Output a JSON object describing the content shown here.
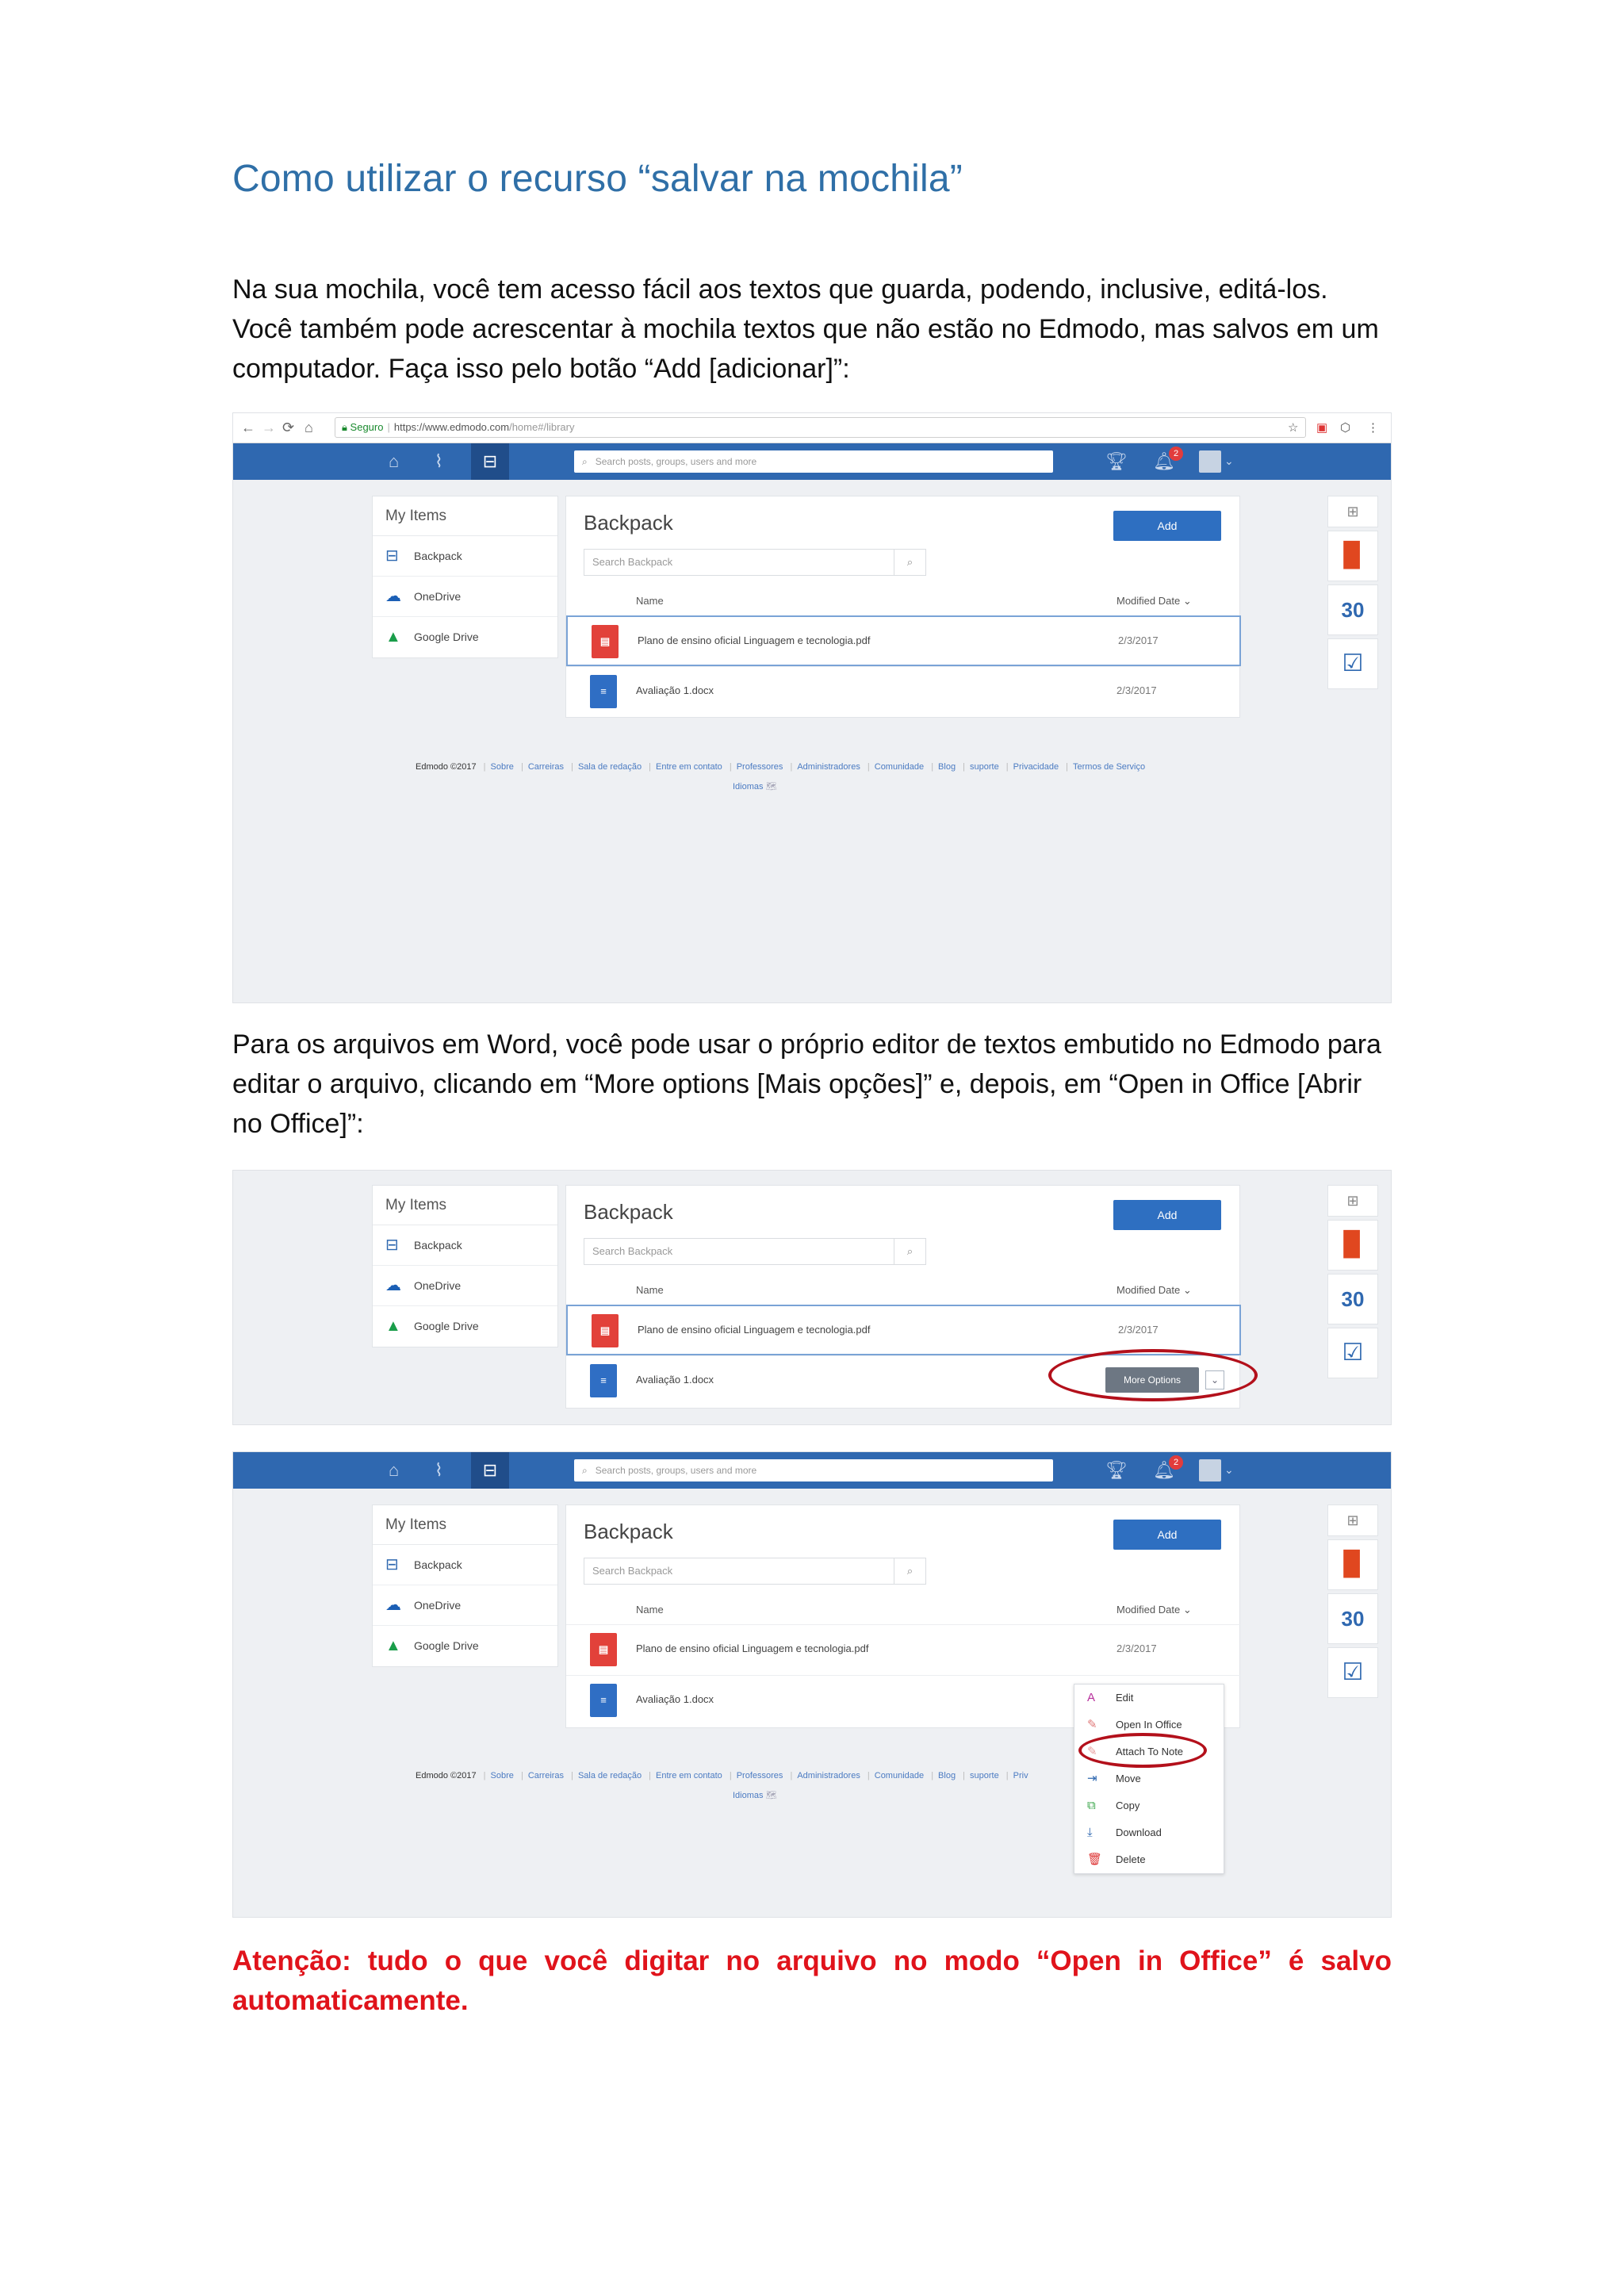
{
  "doc": {
    "title": "Como utilizar o recurso “salvar na mochila”",
    "p1": "Na sua mochila, você tem acesso fácil aos textos que guarda, podendo, inclusive, editá-los. Você também pode acrescentar à mochila textos que não estão no Edmodo, mas salvos em um computador. Faça isso pelo botão “Add [adicionar]”:",
    "p2": "Para os arquivos em Word, você pode usar o próprio editor de textos embutido no Edmodo para editar o arquivo, clicando em “More options [Mais opções]” e, depois, em “Open in Office [Abrir no Office]”:",
    "warning": "Atenção: tudo o que você digitar no arquivo no modo “Open in Office” é salvo automaticamente."
  },
  "browser": {
    "secure": "Seguro",
    "url_host": "https://www.edmodo.com",
    "url_path": "/home#/library"
  },
  "topbar": {
    "search_placeholder": "Search posts, groups, users and more",
    "notification_count": "2"
  },
  "sidebar": {
    "header": "My Items",
    "items": [
      {
        "label": "Backpack",
        "icon": "backpack-icon"
      },
      {
        "label": "OneDrive",
        "icon": "onedrive-icon"
      },
      {
        "label": "Google Drive",
        "icon": "google-drive-icon"
      }
    ]
  },
  "backpack": {
    "title": "Backpack",
    "add_label": "Add",
    "search_placeholder": "Search Backpack",
    "col_name": "Name",
    "col_date": "Modified Date ⌄",
    "files": [
      {
        "name": "Plano de ensino oficial Linguagem e tecnologia.pdf",
        "date": "2/3/2017",
        "type": "pdf"
      },
      {
        "name": "Avaliação 1.docx",
        "date": "2/3/2017",
        "type": "docx"
      }
    ],
    "more_options": "More Options"
  },
  "rail": {
    "calendar_day": "30"
  },
  "footer": {
    "copyright": "Edmodo ©2017",
    "links": [
      "Sobre",
      "Carreiras",
      "Sala de redação",
      "Entre em contato",
      "Professores",
      "Administradores",
      "Comunidade",
      "Blog",
      "suporte",
      "Privacidade",
      "Termos de Serviço"
    ],
    "links_short": [
      "Sobre",
      "Carreiras",
      "Sala de redação",
      "Entre em contato",
      "Professores",
      "Administradores",
      "Comunidade",
      "Blog",
      "suporte",
      "Priv"
    ],
    "languages": "Idiomas"
  },
  "menu": {
    "items": [
      {
        "label": "Edit",
        "icon": "edit-icon"
      },
      {
        "label": "Open In Office",
        "icon": "office-pencil-icon"
      },
      {
        "label": "Attach To Note",
        "icon": "note-icon"
      },
      {
        "label": "Move",
        "icon": "move-icon"
      },
      {
        "label": "Copy",
        "icon": "copy-icon"
      },
      {
        "label": "Download",
        "icon": "download-icon"
      },
      {
        "label": "Delete",
        "icon": "trash-icon"
      }
    ]
  },
  "colors": {
    "title_blue": "#2f6fa7",
    "edmodo_blue": "#2f68b0",
    "warning_red": "#e0131b",
    "highlight_oval": "#b3101b"
  }
}
